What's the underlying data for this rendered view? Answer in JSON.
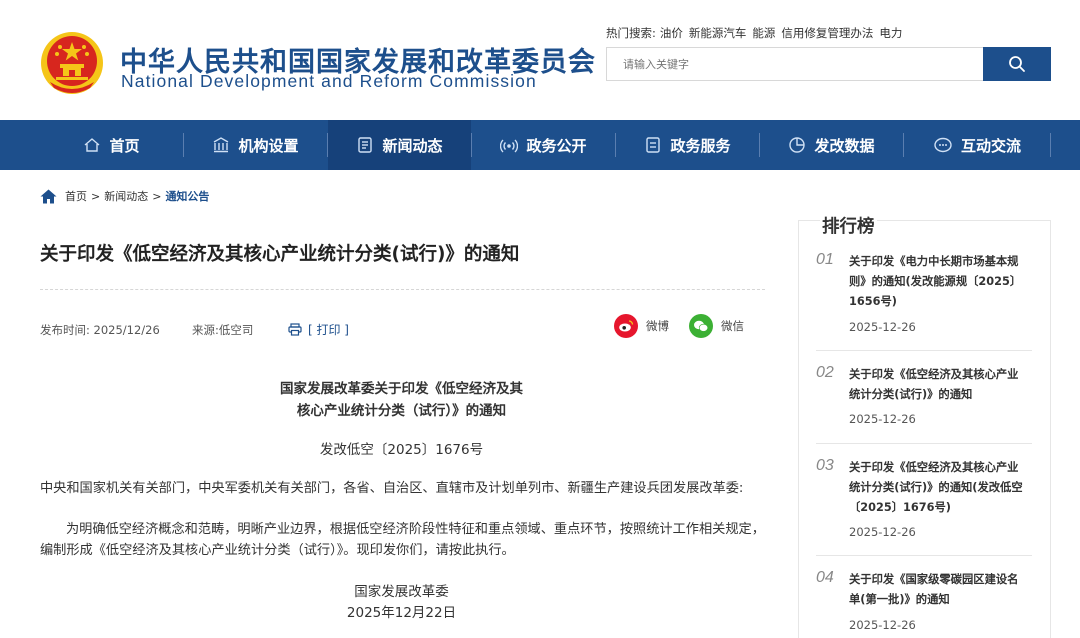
{
  "header": {
    "title_cn": "中华人民共和国国家发展和改革委员会",
    "title_en": "National Development and Reform Commission",
    "hot_label": "热门搜索:",
    "hot_terms": [
      "油价",
      "新能源汽车",
      "能源",
      "信用修复管理办法",
      "电力"
    ],
    "search_placeholder": "请输入关键字"
  },
  "nav": {
    "items": [
      {
        "label": "首页",
        "icon": "home-icon"
      },
      {
        "label": "机构设置",
        "icon": "building-icon"
      },
      {
        "label": "新闻动态",
        "icon": "news-icon"
      },
      {
        "label": "政务公开",
        "icon": "broadcast-icon"
      },
      {
        "label": "政务服务",
        "icon": "document-icon"
      },
      {
        "label": "发改数据",
        "icon": "pie-chart-icon"
      },
      {
        "label": "互动交流",
        "icon": "chat-icon"
      }
    ],
    "active_index": 2
  },
  "breadcrumb": {
    "items": [
      "首页",
      "新闻动态",
      "通知公告"
    ],
    "separator": ">"
  },
  "article": {
    "title": "关于印发《低空经济及其核心产业统计分类(试行)》的通知",
    "publish_label": "发布时间:",
    "publish_date": "2025/12/26",
    "source_label": "来源:",
    "source": "低空司",
    "print_label": "[ 打印 ]",
    "share_weibo": "微博",
    "share_wechat": "微信",
    "doc_heading_line1": "国家发展改革委关于印发《低空经济及其",
    "doc_heading_line2": "核心产业统计分类（试行）》的通知",
    "doc_number": "发改低空〔2025〕1676号",
    "recipients": "中央和国家机关有关部门，中央军委机关有关部门，各省、自治区、直辖市及计划单列市、新疆生产建设兵团发展改革委:",
    "body": "为明确低空经济概念和范畴，明晰产业边界，根据低空经济阶段性特征和重点领域、重点环节，按照统计工作相关规定，编制形成《低空经济及其核心产业统计分类（试行）》。现印发你们，请按此执行。",
    "signer": "国家发展改革委",
    "sign_date": "2025年12月22日"
  },
  "ranking": {
    "title": "排行榜",
    "items": [
      {
        "num": "01",
        "title": "关于印发《电力中长期市场基本规则》的通知(发改能源规〔2025〕1656号)",
        "date": "2025-12-26"
      },
      {
        "num": "02",
        "title": "关于印发《低空经济及其核心产业统计分类(试行)》的通知",
        "date": "2025-12-26"
      },
      {
        "num": "03",
        "title": "关于印发《低空经济及其核心产业统计分类(试行)》的通知(发改低空〔2025〕1676号)",
        "date": "2025-12-26"
      },
      {
        "num": "04",
        "title": "关于印发《国家级零碳园区建设名单(第一批)》的通知",
        "date": "2025-12-26"
      }
    ]
  },
  "colors": {
    "brand_blue": "#1d4f8c",
    "nav_active": "#16417a",
    "emblem_red": "#d7261e",
    "emblem_gold": "#f5c518",
    "weibo_red": "#e6162d",
    "wechat_green": "#3cb034"
  }
}
